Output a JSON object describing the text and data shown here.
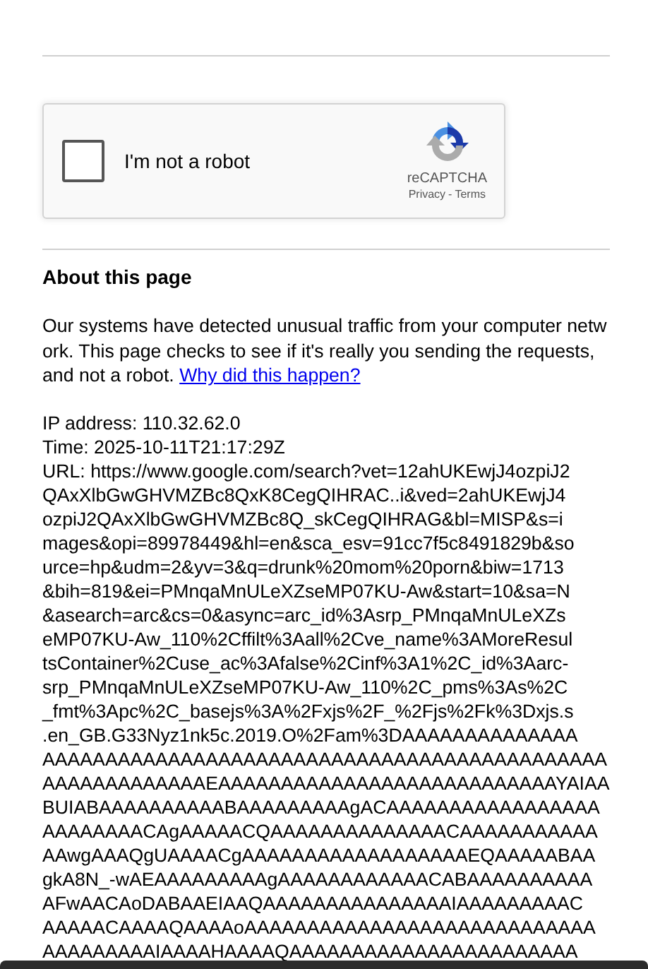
{
  "captcha": {
    "label": "I'm not a robot",
    "checked": false,
    "brand": "reCAPTCHA",
    "privacy_link": "Privacy",
    "separator": "-",
    "terms_link": "Terms"
  },
  "about": {
    "heading": "About this page",
    "paragraph": "Our systems have detected unusual traffic from your computer network. This page checks to see if it's really you sending the requests, and not a robot.",
    "link": "Why did this happen?"
  },
  "details": {
    "ip": "IP address: 110.32.62.0",
    "time": "Time: 2025-10-11T21:17:29Z",
    "url_lines": [
      "URL: https://www.google.com/search?vet=12ahUKEwjJ4ozpiJ2",
      "QAxXlbGwGHVMZBc8QxK8CegQIHRAC..i&ved=2ahUKEwjJ4",
      "ozpiJ2QAxXlbGwGHVMZBc8Q_skCegQIHRAG&bl=MISP&s=i",
      "mages&opi=89978449&hl=en&sca_esv=91cc7f5c8491829b&so",
      "urce=hp&udm=2&yv=3&q=drunk%20mom%20porn&biw=1713",
      "&bih=819&ei=PMnqaMnULeXZseMP07KU-Aw&start=10&sa=N",
      "&asearch=arc&cs=0&async=arc_id%3Asrp_PMnqaMnULeXZs",
      "eMP07KU-Aw_110%2Cffilt%3Aall%2Cve_name%3AMoreResul",
      "tsContainer%2Cuse_ac%3Afalse%2Cinf%3A1%2C_id%3Aarc-",
      "srp_PMnqaMnULeXZseMP07KU-Aw_110%2C_pms%3As%2C",
      "_fmt%3Apc%2C_basejs%3A%2Fxjs%2F_%2Fjs%2Fk%3Dxjs.s",
      ".en_GB.G33Nyz1nk5c.2019.O%2Fam%3DAAAAAAAAAAAAAA",
      "AAAAAAAAAAAAAAAAAAAAAAAAAAAAAAAAAAAAAAAAAAAAA",
      "AAAAAAAAAAAAAEAAAAAAAAAAAAAAAAAAAAAAAAAAAYAIAA",
      "BUIABAAAAAAAAAABAAAAAAAAAgACAAAAAAAAAAAAAAAAA",
      "AAAAAAAACAgAAAAACQAAAAAAAAAAAAAACAAAAAAAAAAA",
      "AAwgAAAQgUAAAACgAAAAAAAAAAAAAAAAAAEQAAAAABAA",
      "gkA8N_-wAEAAAAAAAAAgAAAAAAAAAAAACABAAAAAAAAAA",
      "AFwAACAoDABAAEIAAQAAAAAAAAAAAAAAAIAAAAAAAAAC",
      "AAAAACAAAAQAAAAoAAAAAAAAAAAAAAAAAAAAAAAAAAAA",
      "AAAAAAAAAIAAAAHAAAAQAAAAAAAAAAAAAAAAAAAAAAA"
    ]
  }
}
